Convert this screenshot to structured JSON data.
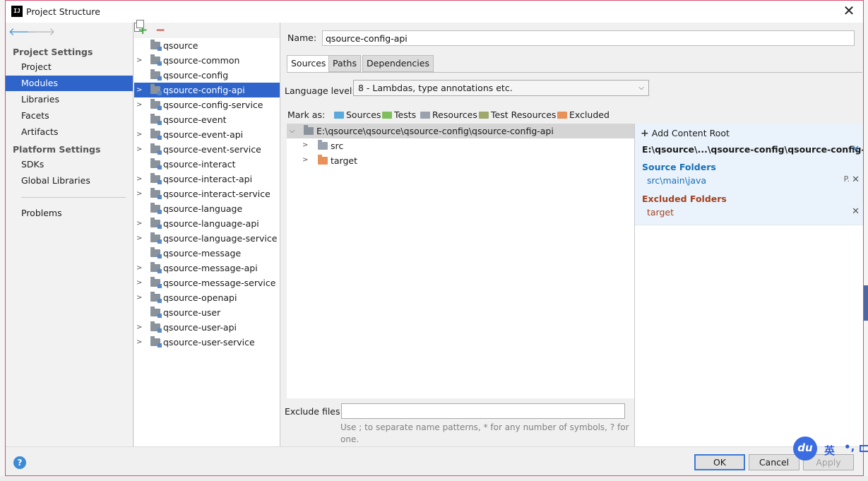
{
  "window": {
    "title": "Project Structure",
    "app_icon_text": "IJ",
    "close_symbol": "✕"
  },
  "nav": {
    "back_symbol": "🡐",
    "forward_symbol": "🡒",
    "project_settings_heading": "Project Settings",
    "project_settings_items": [
      "Project",
      "Modules",
      "Libraries",
      "Facets",
      "Artifacts"
    ],
    "selected_item": "Modules",
    "platform_settings_heading": "Platform Settings",
    "platform_settings_items": [
      "SDKs",
      "Global Libraries"
    ],
    "problems_label": "Problems"
  },
  "modules": {
    "add_symbol": "+",
    "remove_symbol": "−",
    "items": [
      {
        "label": "qsource",
        "expandable": false
      },
      {
        "label": "qsource-common",
        "expandable": true
      },
      {
        "label": "qsource-config",
        "expandable": false
      },
      {
        "label": "qsource-config-api",
        "expandable": true,
        "selected": true
      },
      {
        "label": "qsource-config-service",
        "expandable": true
      },
      {
        "label": "qsource-event",
        "expandable": false
      },
      {
        "label": "qsource-event-api",
        "expandable": true
      },
      {
        "label": "qsource-event-service",
        "expandable": true
      },
      {
        "label": "qsource-interact",
        "expandable": false
      },
      {
        "label": "qsource-interact-api",
        "expandable": true
      },
      {
        "label": "qsource-interact-service",
        "expandable": true
      },
      {
        "label": "qsource-language",
        "expandable": false
      },
      {
        "label": "qsource-language-api",
        "expandable": true
      },
      {
        "label": "qsource-language-service",
        "expandable": true
      },
      {
        "label": "qsource-message",
        "expandable": false
      },
      {
        "label": "qsource-message-api",
        "expandable": true
      },
      {
        "label": "qsource-message-service",
        "expandable": true
      },
      {
        "label": "qsource-openapi",
        "expandable": true
      },
      {
        "label": "qsource-user",
        "expandable": false
      },
      {
        "label": "qsource-user-api",
        "expandable": true
      },
      {
        "label": "qsource-user-service",
        "expandable": true
      }
    ]
  },
  "content": {
    "name_label": "Name:",
    "name_value": "qsource-config-api",
    "tabs": [
      "Sources",
      "Paths",
      "Dependencies"
    ],
    "active_tab": "Sources",
    "language_level_label": "Language level:",
    "language_level_value": "8 - Lambdas, type annotations etc.",
    "mark_as_label": "Mark as:",
    "mark_as": [
      {
        "label": "Sources",
        "color": "#5aa8dc"
      },
      {
        "label": "Tests",
        "color": "#7fbf5b"
      },
      {
        "label": "Resources",
        "color": "#9aa3ad"
      },
      {
        "label": "Test Resources",
        "color": "#a2a86b"
      },
      {
        "label": "Excluded",
        "color": "#e8915a"
      }
    ],
    "tree": {
      "root": "E:\\qsource\\qsource\\qsource-config\\qsource-config-api",
      "children": [
        {
          "label": "src",
          "color": "#9aa3ad"
        },
        {
          "label": "target",
          "color": "#e8915a"
        }
      ]
    },
    "exclude_files_label": "Exclude files:",
    "exclude_files_value": "",
    "exclude_hint": "Use ; to separate name patterns, * for any number of symbols, ? for one."
  },
  "roots": {
    "add_content_root": "Add Content Root",
    "root_path": "E:\\qsource\\...\\qsource-config\\qsource-config-api",
    "source_folders_heading": "Source Folders",
    "source_folder": "src\\main\\java",
    "excluded_folders_heading": "Excluded Folders",
    "excluded_folder": "target",
    "remove_symbol": "✕",
    "edit_symbol": "P."
  },
  "footer": {
    "help_symbol": "?",
    "ok_label": "OK",
    "cancel_label": "Cancel",
    "apply_label": "Apply"
  },
  "ime": {
    "logo": "du",
    "lang": "英",
    "punct": "•,"
  }
}
